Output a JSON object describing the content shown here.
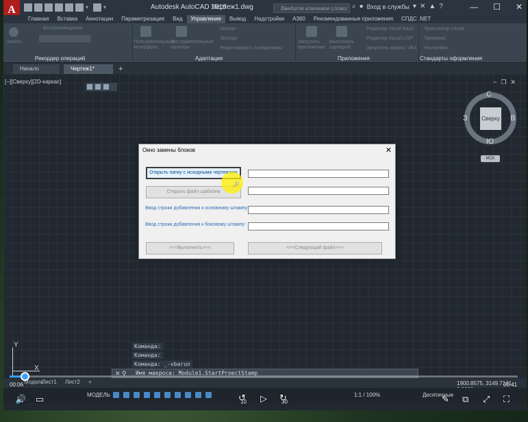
{
  "app": {
    "logo_letter": "A",
    "title": "Autodesk AutoCAD 2018",
    "document": "Чертеж1.dwg",
    "search_placeholder": "Введите ключевое слово/фразу",
    "signin": "Вход в службы",
    "window_controls": [
      "—",
      "☐",
      "✕"
    ]
  },
  "ribbon": {
    "tabs": [
      "Главная",
      "Вставка",
      "Аннотации",
      "Параметризация",
      "Вид",
      "Управление",
      "Вывод",
      "Надстройки",
      "A360",
      "Рекомендованные приложения",
      "СПДС .NET"
    ],
    "active_tab": "Управление",
    "items": {
      "record": "Запись",
      "rec_play": "Воспроизведение",
      "cui": "Пользовательский интерфейс",
      "tool_palettes": "Инструментальные палитры",
      "import": "Импорт",
      "export": "Экспорт",
      "edit_aliases": "Редактировать псевдонимы",
      "load_app": "Загрузить приложение",
      "run_script": "Выполнить сценарий",
      "vb_editor": "Редактор Visual Basic",
      "vlisp_editor": "Редактор Visual LISP",
      "run_vba": "Запустить макрос VBA",
      "std_convert": "Транслятор слоев",
      "std_check": "Проверка",
      "std_config": "Настройки"
    },
    "panels": [
      "Рекордер операций",
      "Адаптация",
      "Приложения",
      "Стандарты оформления"
    ]
  },
  "file_tabs": [
    "Начало",
    "Чертеж1*"
  ],
  "viewport": {
    "label": "[−][Сверху][2D-каркас]",
    "viewcube": {
      "face": "Сверху",
      "north": "С",
      "south": "Ю",
      "west": "З",
      "east": "В"
    },
    "wcs": "МСК",
    "ucs_x": "X",
    "ucs_y": "Y"
  },
  "command": {
    "history": [
      "Команда:",
      "Команда:",
      "Команда:  _-vbarun"
    ],
    "current": "Имя макроса: Module1.StartProectStamp"
  },
  "layout_tabs": [
    "Модель",
    "Лист1",
    "Лист2"
  ],
  "status": {
    "coords": "1900.8575, 3149.7141, 0.0000",
    "model": "МОДЕЛЬ",
    "scale": "1:1 / 100%",
    "units": "Десятичные"
  },
  "player": {
    "elapsed": "00:06",
    "total": "00:41",
    "progress": 0.03,
    "skip_back": "10",
    "skip_forward": "30"
  },
  "dialog": {
    "title": "Окно замены блоков",
    "open_folder": "Открыть папку с исходными чертежами",
    "open_template": "Открыть файл шаблона",
    "main_stamp_label": "Ввод строки добавления к основному штампу:",
    "side_stamp_label": "Ввод строки добавления к боковому штампу:",
    "execute": "<<<Выполнить>>>",
    "next_file": "<<<Следующий файл>>>"
  }
}
